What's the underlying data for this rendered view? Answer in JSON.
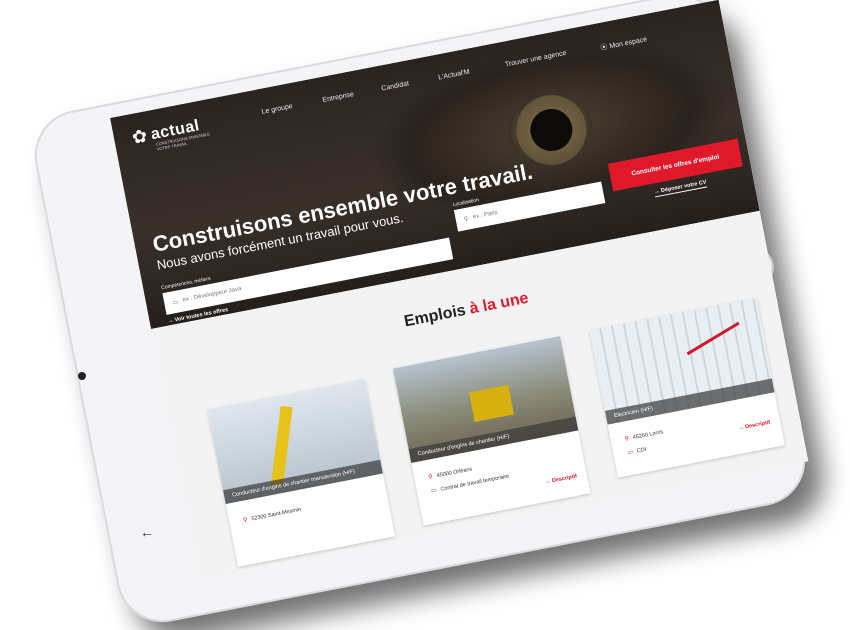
{
  "logo": {
    "text": "actual",
    "tagline": "CONSTRUISONS ENSEMBLE VOTRE TRAVAIL"
  },
  "nav": [
    "Le groupe",
    "Entreprise",
    "Candidat",
    "L'Actual'M",
    "Trouver une agence",
    "Mon espace"
  ],
  "hero": {
    "title": "Construisons ensemble votre travail.",
    "subtitle": "Nous avons forcément un travail pour vous.",
    "skills_label": "Compétences, métiers",
    "skills_placeholder": "ex : Développeur Java",
    "location_label": "Localisation",
    "location_placeholder": "ex : Paris",
    "cta": "Consulter les offres d'emploi",
    "all_offers_link": "→ Voir toutes les offres",
    "cv_link": "→ Déposer votre CV"
  },
  "section": {
    "title_main": "Emplois",
    "title_accent": "à la une"
  },
  "cards": [
    {
      "caption": "Conducteur d'engins de chantier manutention (H/F)",
      "city": "52300 Saint-Mesmin"
    },
    {
      "caption": "Conducteur d'engins de chantier (H/F)",
      "city": "45000 Orléans",
      "contract": "Contrat de travail temporaire",
      "link": "→ Descriptif"
    },
    {
      "caption": "Electricien (H/F)",
      "city": "45260 Lorris",
      "contract": "CDI",
      "link": "→ Descriptif"
    }
  ],
  "colors": {
    "accent": "#e0192a",
    "hero_dark": "#2a2421"
  }
}
